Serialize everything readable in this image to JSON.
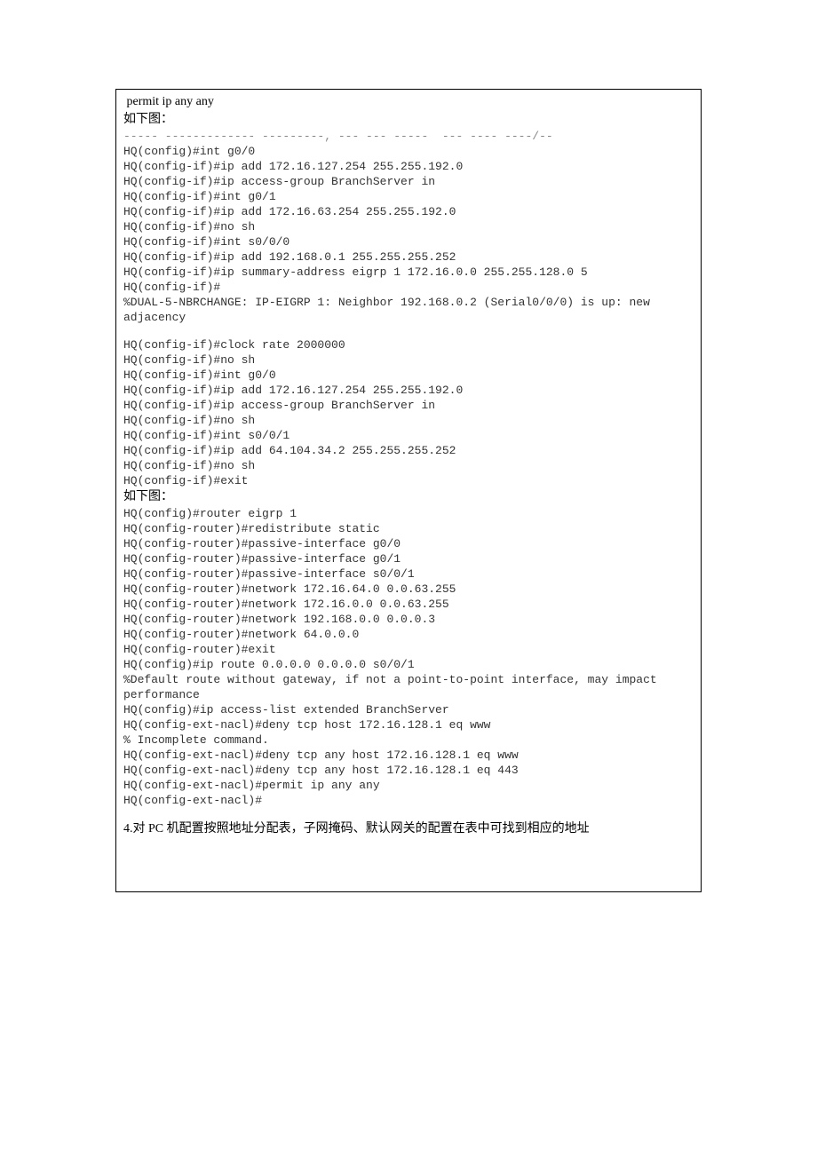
{
  "header": {
    "permit": " permit ip any any",
    "caption1": "如下图："
  },
  "block1": {
    "faded": "----- ------------- ---------, --- --- -----  --- ---- ----/--",
    "lines": [
      "HQ(config)#int g0/0",
      "HQ(config-if)#ip add 172.16.127.254 255.255.192.0",
      "HQ(config-if)#ip access-group BranchServer in",
      "HQ(config-if)#int g0/1",
      "HQ(config-if)#ip add 172.16.63.254 255.255.192.0",
      "HQ(config-if)#no sh",
      "HQ(config-if)#int s0/0/0",
      "HQ(config-if)#ip add 192.168.0.1 255.255.255.252",
      "HQ(config-if)#ip summary-address eigrp 1 172.16.0.0 255.255.128.0 5",
      "HQ(config-if)#",
      "%DUAL-5-NBRCHANGE: IP-EIGRP 1: Neighbor 192.168.0.2 (Serial0/0/0) is up: new",
      "adjacency"
    ],
    "lines2": [
      "HQ(config-if)#clock rate 2000000",
      "HQ(config-if)#no sh",
      "HQ(config-if)#int g0/0",
      "HQ(config-if)#ip add 172.16.127.254 255.255.192.0",
      "HQ(config-if)#ip access-group BranchServer in",
      "HQ(config-if)#no sh",
      "HQ(config-if)#int s0/0/1",
      "HQ(config-if)#ip add 64.104.34.2 255.255.255.252",
      "HQ(config-if)#no sh",
      "HQ(config-if)#exit"
    ]
  },
  "caption2": "如下图：",
  "block2": {
    "lines": [
      "HQ(config)#router eigrp 1",
      "HQ(config-router)#redistribute static",
      "HQ(config-router)#passive-interface g0/0",
      "HQ(config-router)#passive-interface g0/1",
      "HQ(config-router)#passive-interface s0/0/1",
      "HQ(config-router)#network 172.16.64.0 0.0.63.255",
      "HQ(config-router)#network 172.16.0.0 0.0.63.255",
      "HQ(config-router)#network 192.168.0.0 0.0.0.3",
      "HQ(config-router)#network 64.0.0.0",
      "HQ(config-router)#exit",
      "HQ(config)#ip route 0.0.0.0 0.0.0.0 s0/0/1",
      "%Default route without gateway, if not a point-to-point interface, may impact",
      "performance",
      "HQ(config)#ip access-list extended BranchServer",
      "HQ(config-ext-nacl)#deny tcp host 172.16.128.1 eq www",
      "% Incomplete command.",
      "HQ(config-ext-nacl)#deny tcp any host 172.16.128.1 eq www",
      "HQ(config-ext-nacl)#deny tcp any host 172.16.128.1 eq 443",
      "HQ(config-ext-nacl)#permit ip any any",
      "HQ(config-ext-nacl)#"
    ]
  },
  "footer": "4.对 PC 机配置按照地址分配表，子网掩码、默认网关的配置在表中可找到相应的地址"
}
